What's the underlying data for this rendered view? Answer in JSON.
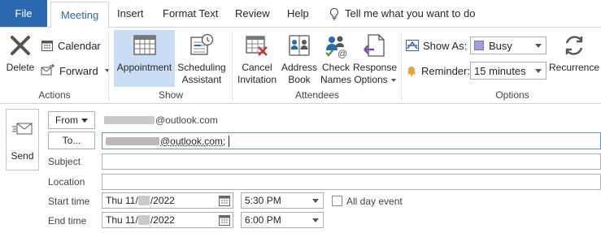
{
  "tabs": {
    "file": "File",
    "meeting": "Meeting",
    "insert": "Insert",
    "format_text": "Format Text",
    "review": "Review",
    "help": "Help",
    "tell_me": "Tell me what you want to do"
  },
  "ribbon": {
    "actions": {
      "delete": "Delete",
      "calendar": "Calendar",
      "forward": "Forward",
      "label": "Actions"
    },
    "show": {
      "appointment": "Appointment",
      "scheduling_1": "Scheduling",
      "scheduling_2": "Assistant",
      "label": "Show"
    },
    "attendees": {
      "cancel_1": "Cancel",
      "cancel_2": "Invitation",
      "address_1": "Address",
      "address_2": "Book",
      "check_1": "Check",
      "check_2": "Names",
      "response_1": "Response",
      "response_2": "Options",
      "label": "Attendees"
    },
    "options": {
      "show_as_label": "Show As:",
      "show_as_value": "Busy",
      "reminder_label": "Reminder:",
      "reminder_value": "15 minutes",
      "recurrence": "Recurrence",
      "label": "Options"
    }
  },
  "form": {
    "send": "Send",
    "from_button": "From",
    "from_value": "@outlook.com",
    "to_button": "To...",
    "to_value": "@outlook.com;",
    "subject_label": "Subject",
    "location_label": "Location",
    "start_label": "Start time",
    "end_label": "End time",
    "start_date_prefix": "Thu 11/",
    "start_date_suffix": "/2022",
    "end_date_prefix": "Thu 11/",
    "end_date_suffix": "/2022",
    "start_time": "5:30 PM",
    "end_time": "6:00 PM",
    "all_day": "All day event"
  },
  "colors": {
    "file_tab": "#2b6ab0",
    "selected_button": "#c9def5",
    "busy_swatch": "#9e9eda"
  }
}
